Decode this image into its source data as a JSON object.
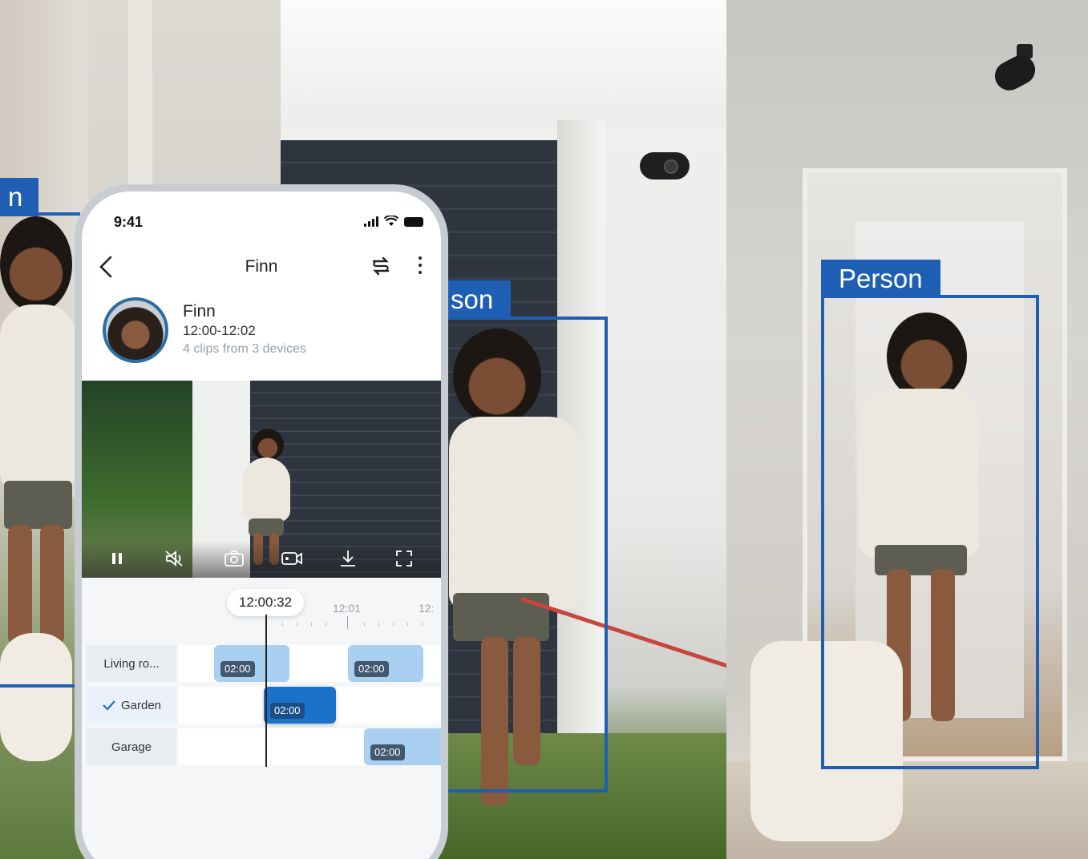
{
  "detection_label": "Person",
  "detection_labels_cropped": {
    "left": "n",
    "middle": "son"
  },
  "colors": {
    "accent": "#1f5fb3",
    "clip": "#a9d0f0",
    "clip_selected": "#1a73c9"
  },
  "phone": {
    "status_time": "9:41",
    "nav": {
      "title": "Finn",
      "back_icon": "chevron-left-icon",
      "swap_icon": "swap-icon",
      "more_icon": "more-vertical-icon"
    },
    "profile": {
      "name": "Finn",
      "time_range": "12:00-12:02",
      "clips_summary": "4 clips from 3 devices"
    },
    "video_controls": [
      "pause-icon",
      "mute-icon",
      "snapshot-icon",
      "record-icon",
      "download-icon",
      "fullscreen-icon"
    ],
    "timeline": {
      "current_time": "12:00:32",
      "tick_labels": [
        "12:01",
        "12:"
      ],
      "rows": [
        {
          "label": "Living ro...",
          "clips": [
            "02:00",
            "02:00"
          ]
        },
        {
          "label": "Garden",
          "checked": true,
          "clips": [
            "02:00"
          ]
        },
        {
          "label": "Garage",
          "clips": [
            "02:00"
          ]
        }
      ]
    }
  }
}
